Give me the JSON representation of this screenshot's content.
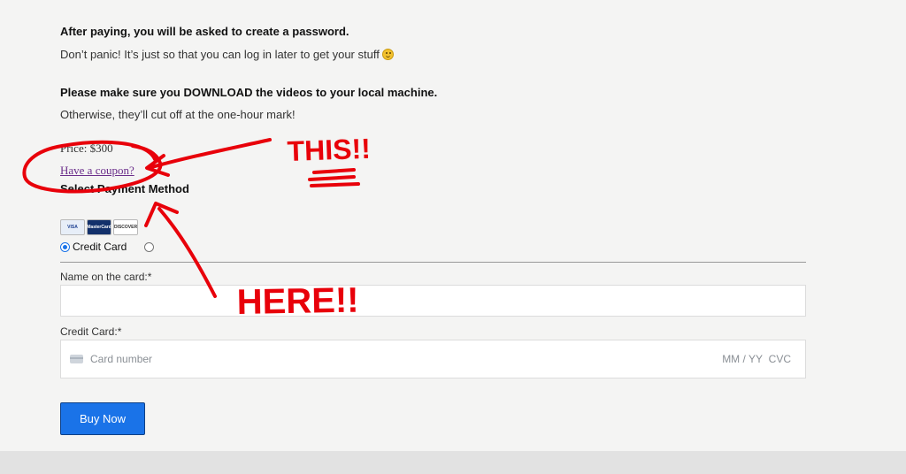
{
  "info": {
    "line1_bold": "After paying, you will be asked to create a password.",
    "line2": "Don’t panic! It’s just so that you can log in later to get your stuff",
    "line3_bold": "Please make sure you DOWNLOAD the videos to your local machine.",
    "line4": "Otherwise, they’ll cut off at the one-hour mark!"
  },
  "checkout": {
    "price": "Price: $300",
    "coupon_link": "Have a coupon?",
    "payment_method_title": "Select Payment Method",
    "card_logos": [
      "VISA",
      "MasterCard",
      "DISCOVER"
    ],
    "payment_option_selected": "Credit Card",
    "name_label": "Name on the card:*",
    "name_value": "",
    "cc_label": "Credit Card:*",
    "cc_placeholder": "Card number",
    "cc_expiry_placeholder": "MM / YY",
    "cc_cvc_placeholder": "CVC",
    "buy_button": "Buy Now"
  },
  "annotations": {
    "this_text": "THIS!!",
    "here_text": "HERE!!",
    "color": "#e8000a"
  },
  "colors": {
    "button_blue": "#1a73e8",
    "link_purple": "#6a2d8a",
    "background": "#f4f4f3"
  }
}
